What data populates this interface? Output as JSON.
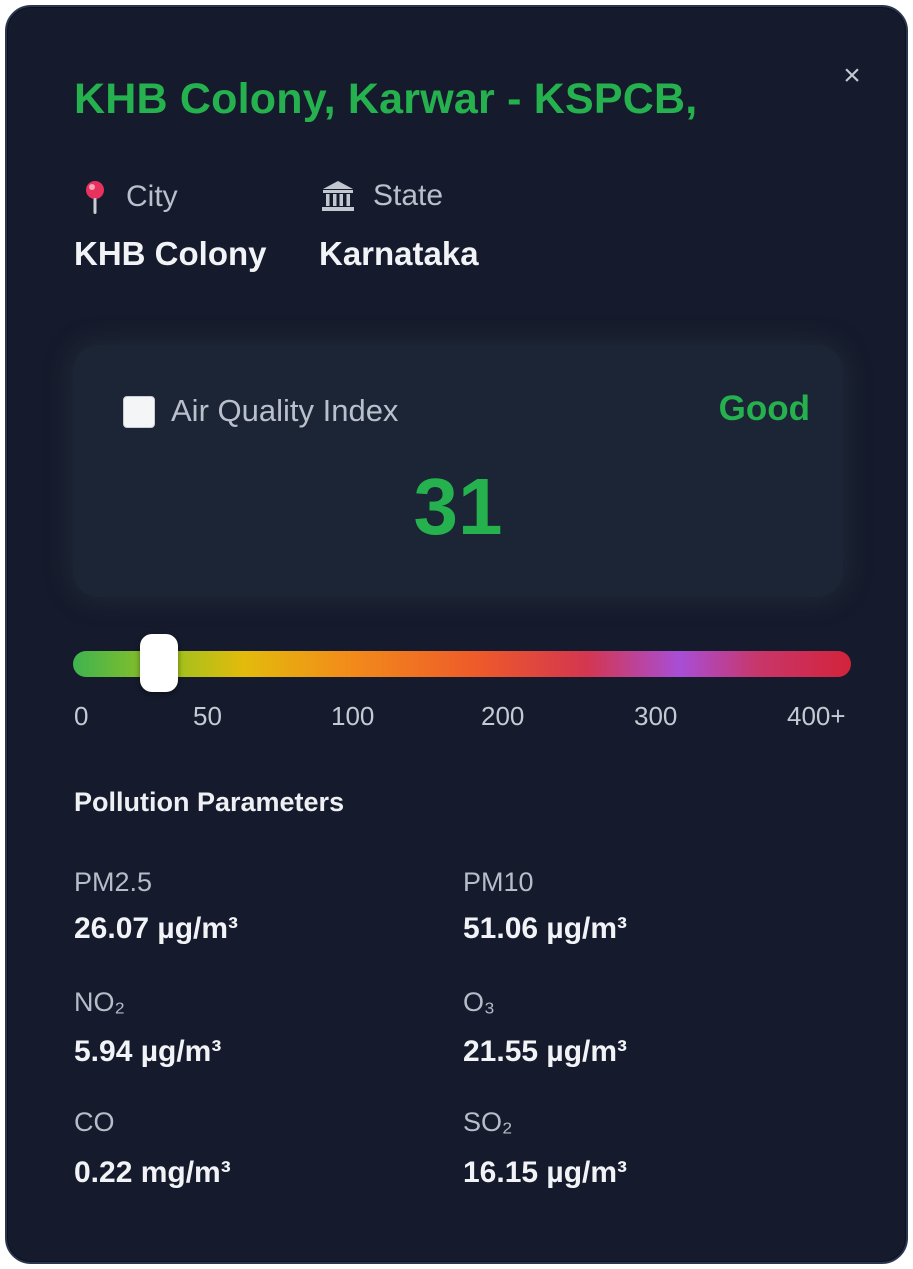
{
  "popup": {
    "title": "KHB Colony, Karwar - KSPCB,",
    "close_label": "×"
  },
  "location": {
    "city_label": "City",
    "city_value": "KHB Colony",
    "state_label": "State",
    "state_value": "Karnataka",
    "city_icon": "map-pin-icon",
    "state_icon": "government-building-icon"
  },
  "aqi": {
    "label": "Air Quality Index",
    "category": "Good",
    "value": "31",
    "category_color": "#25b24e"
  },
  "scale": {
    "ticks": [
      "0",
      "50",
      "100",
      "200",
      "300",
      "400+"
    ],
    "current_value": 31
  },
  "parameters": {
    "section_title": "Pollution Parameters",
    "items": [
      {
        "label": "PM2.5",
        "value": "26.07 µg/m³"
      },
      {
        "label": "PM10",
        "value": "51.06 µg/m³"
      },
      {
        "label": "NO₂",
        "value": "5.94 µg/m³"
      },
      {
        "label": "O₃",
        "value": "21.55 µg/m³"
      },
      {
        "label": "CO",
        "value": "0.22 mg/m³"
      },
      {
        "label": "SO₂",
        "value": "16.15 µg/m³"
      }
    ]
  }
}
